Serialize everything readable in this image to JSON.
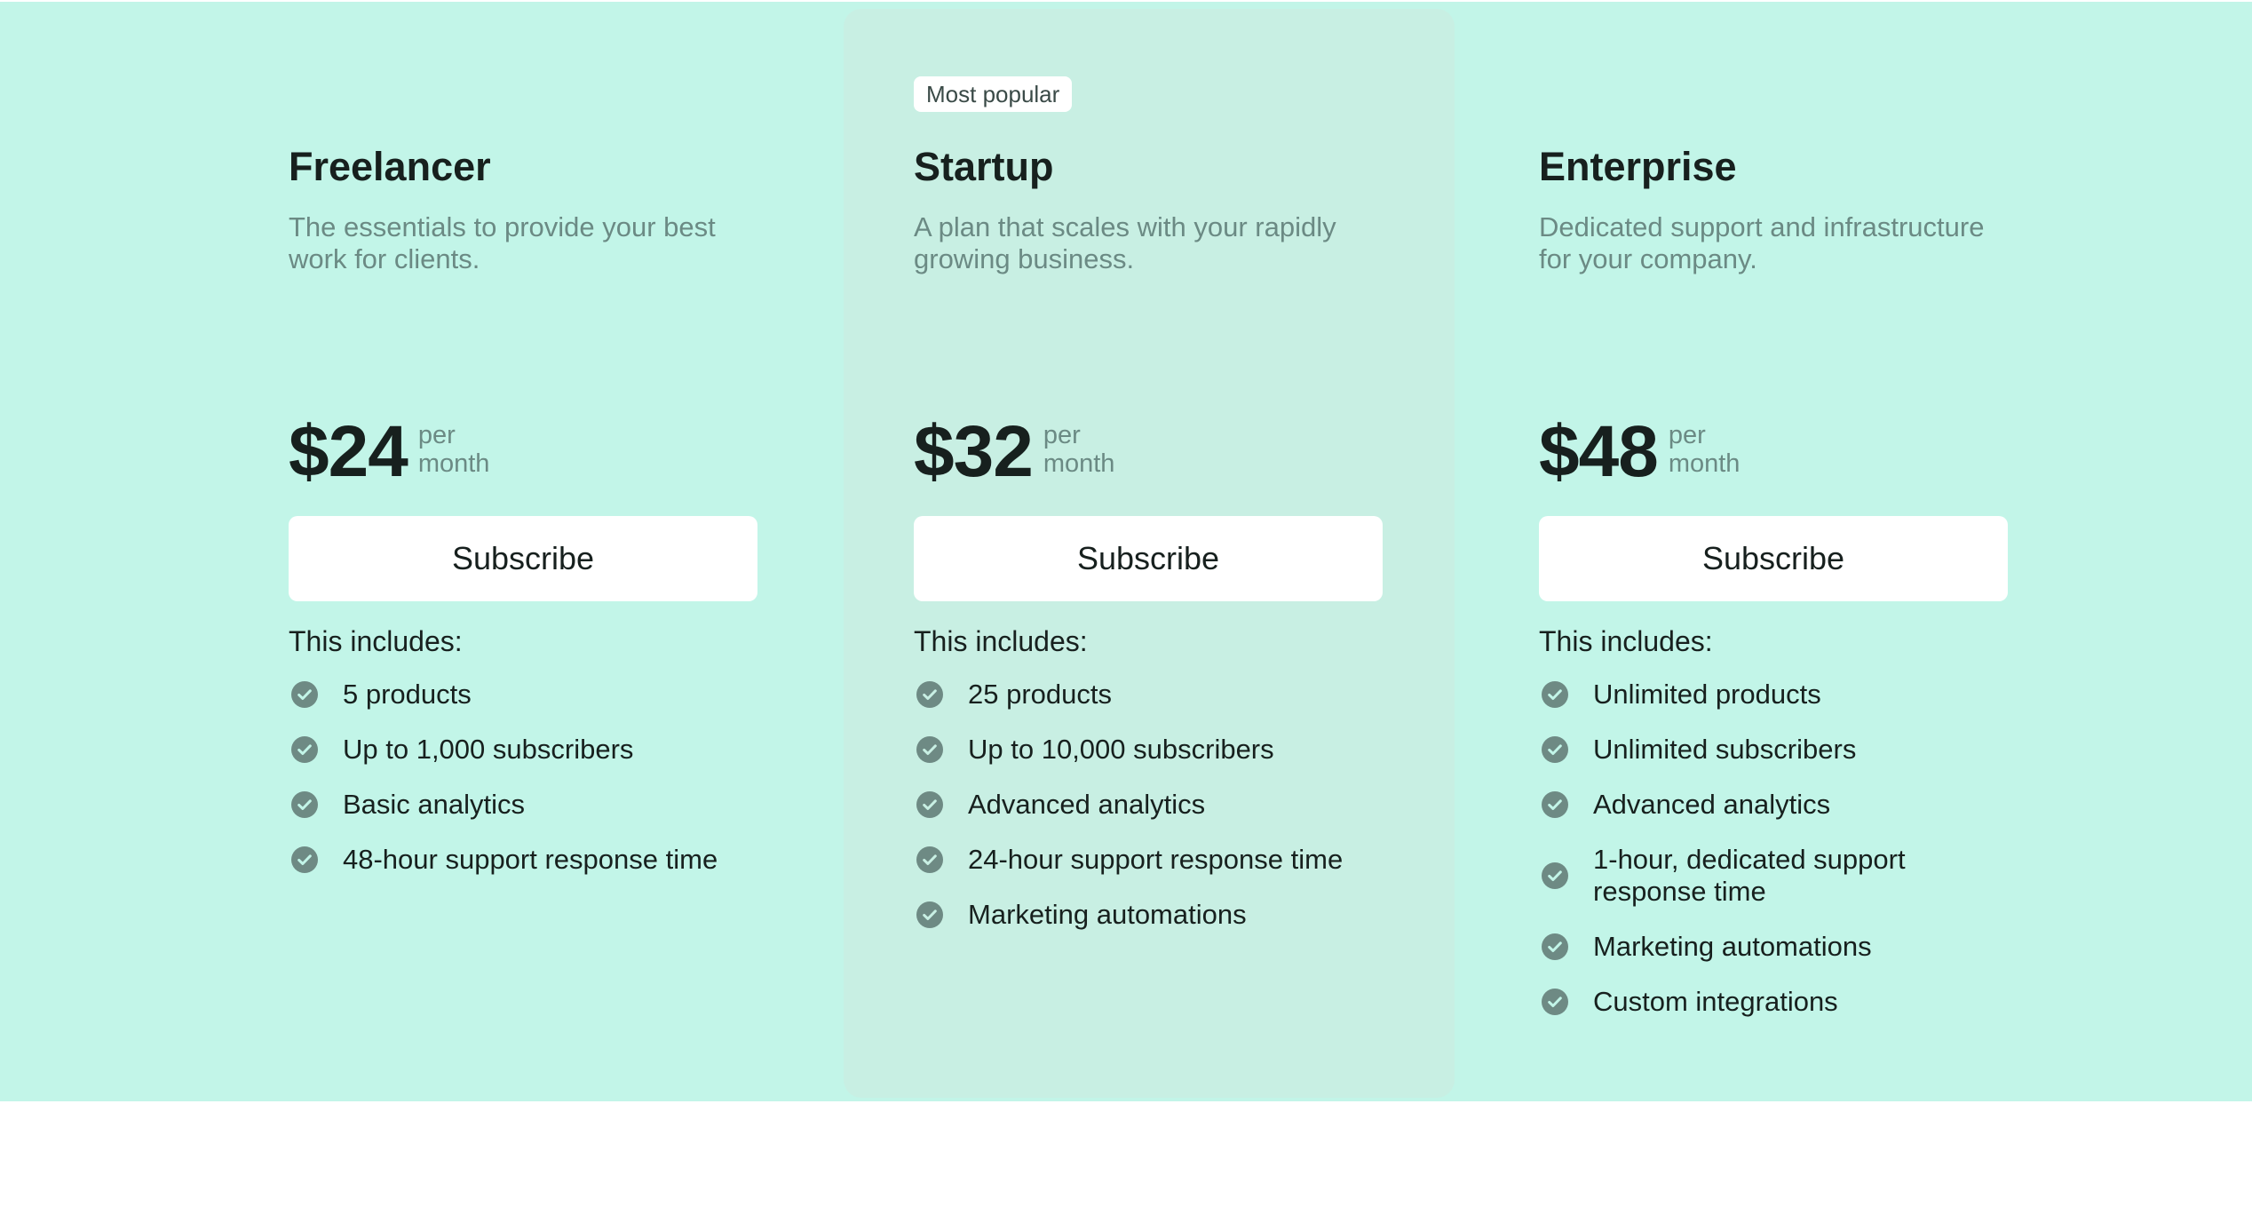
{
  "colors": {
    "section_background": "#c2f5e8",
    "highlight_background": "#c8efe3",
    "button_background": "#ffffff",
    "check_icon": "#6e8a84",
    "muted_text": "#6b8a84",
    "text": "#17201e"
  },
  "plans": [
    {
      "name": "Freelancer",
      "description": "The essentials to provide your best work for clients.",
      "price": "$24",
      "period": "per month",
      "button_label": "Subscribe",
      "includes_label": "This includes:",
      "features": [
        "5 products",
        "Up to 1,000 subscribers",
        "Basic analytics",
        "48-hour support response time"
      ]
    },
    {
      "badge": "Most popular",
      "name": "Startup",
      "description": "A plan that scales with your rapidly growing business.",
      "price": "$32",
      "period": "per month",
      "button_label": "Subscribe",
      "includes_label": "This includes:",
      "features": [
        "25 products",
        "Up to 10,000 subscribers",
        "Advanced analytics",
        "24-hour support response time",
        "Marketing automations"
      ]
    },
    {
      "name": "Enterprise",
      "description": "Dedicated support and infrastructure for your company.",
      "price": "$48",
      "period": "per month",
      "button_label": "Subscribe",
      "includes_label": "This includes:",
      "features": [
        "Unlimited products",
        "Unlimited subscribers",
        "Advanced analytics",
        "1-hour, dedicated support response time",
        "Marketing automations",
        "Custom integrations"
      ]
    }
  ]
}
